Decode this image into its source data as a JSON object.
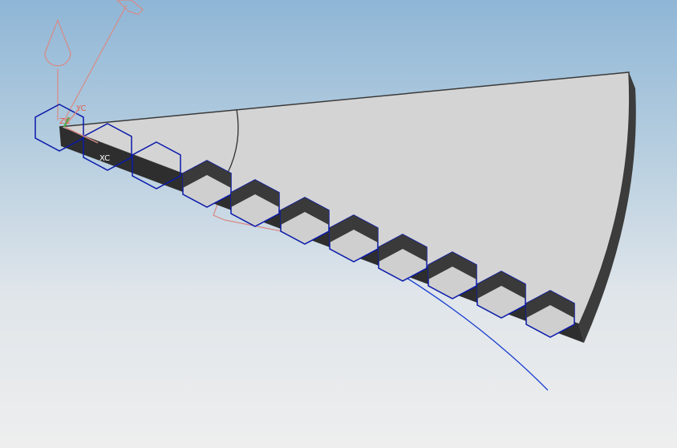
{
  "viewport": {
    "axis_labels": {
      "xc": "XC",
      "yc": "YC",
      "zc": "ZC"
    }
  },
  "colors": {
    "background_top": "#8fb6d6",
    "background_bottom": "#eeeeee",
    "part_face": "#d4d4d4",
    "part_side": "#3a3a3a",
    "teeth_outline": "#0a1aaa",
    "guide_curve": "#1a3fd0",
    "datum_csys": "#d88a84",
    "wcs_z_axis": "#49b049"
  }
}
